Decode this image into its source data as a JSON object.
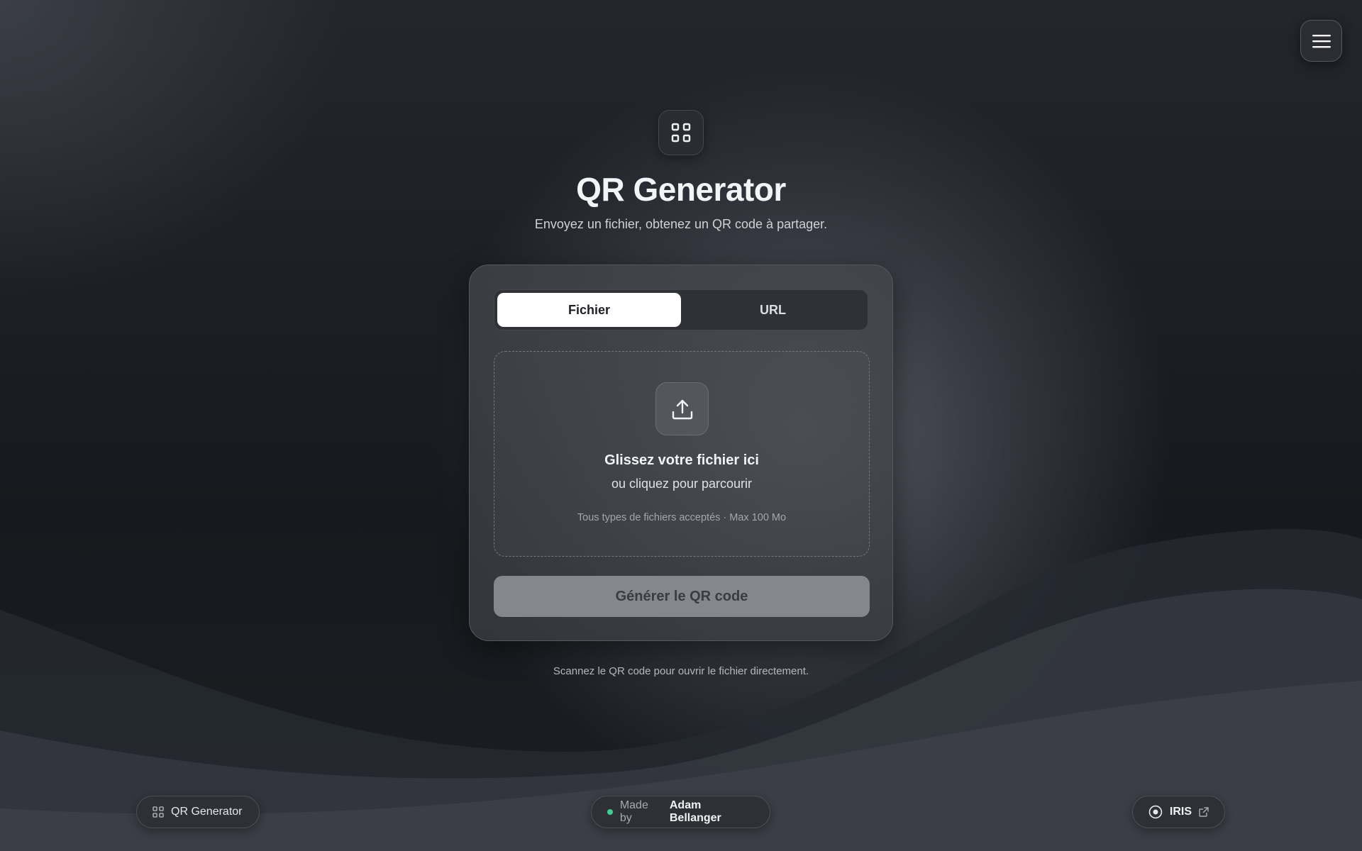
{
  "header": {
    "title": "QR Generator",
    "subtitle": "Envoyez un fichier, obtenez un QR code à partager.",
    "menu_icon": "hamburger-icon",
    "logo_icon": "qr-scan-icon"
  },
  "card": {
    "tabs": [
      {
        "label": "Fichier",
        "active": true
      },
      {
        "label": "URL",
        "active": false
      }
    ],
    "dropzone": {
      "icon": "upload-icon",
      "title": "Glissez votre fichier ici",
      "subtitle": "ou cliquez pour parcourir",
      "note": "Tous types de fichiers acceptés · Max 100 Mo"
    },
    "generate_label": "Générer le QR code"
  },
  "footnote": "Scannez le QR code pour ouvrir le fichier directement.",
  "footer": {
    "left_label": "QR Generator",
    "made_by_prefix": "Made by",
    "author": "Adam Bellanger",
    "right_label": "IRIS"
  },
  "colors": {
    "status_dot": "#3ecf8e",
    "active_tab": "#ffffff",
    "button_disabled": "#85878c"
  }
}
